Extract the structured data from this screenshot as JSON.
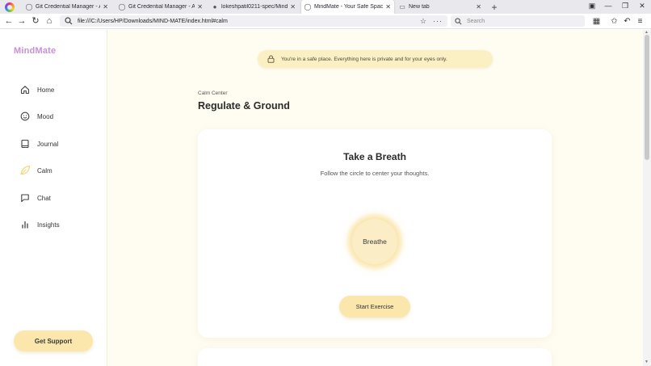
{
  "browser": {
    "tabs": [
      {
        "title": "Git Credential Manager - Auth",
        "icon": "globe-icon",
        "active": false
      },
      {
        "title": "Git Credential Manager - Auth",
        "icon": "globe-icon",
        "active": false
      },
      {
        "title": "lokeshpatil0211-spec/MindM",
        "icon": "github-icon",
        "active": false
      },
      {
        "title": "MindMate - Your Safe Space",
        "icon": "globe-icon",
        "active": true
      },
      {
        "title": "New tab",
        "icon": "page-icon",
        "active": false
      }
    ],
    "url": "file:///C:/Users/HP/Downloads/MIND-MATE/index.html#calm",
    "search_placeholder": "Search"
  },
  "sidebar": {
    "brand": "MindMate",
    "items": [
      {
        "label": "Home",
        "icon": "home-icon",
        "active": false
      },
      {
        "label": "Mood",
        "icon": "smile-icon",
        "active": false
      },
      {
        "label": "Journal",
        "icon": "book-icon",
        "active": false
      },
      {
        "label": "Calm",
        "icon": "leaf-icon",
        "active": true
      },
      {
        "label": "Chat",
        "icon": "chat-icon",
        "active": false
      },
      {
        "label": "Insights",
        "icon": "chart-icon",
        "active": false
      }
    ],
    "support_label": "Get Support"
  },
  "main": {
    "privacy_notice": "You're in a safe place. Everything here is private and for your eyes only.",
    "kicker": "Calm Center",
    "title": "Regulate & Ground",
    "card": {
      "title": "Take a Breath",
      "subtitle": "Follow the circle to center your thoughts.",
      "circle_label": "Breathe",
      "button_label": "Start Exercise"
    }
  },
  "colors": {
    "background": "#fffdf2",
    "accent": "#fbe6ac",
    "brand": "#c790d6"
  }
}
